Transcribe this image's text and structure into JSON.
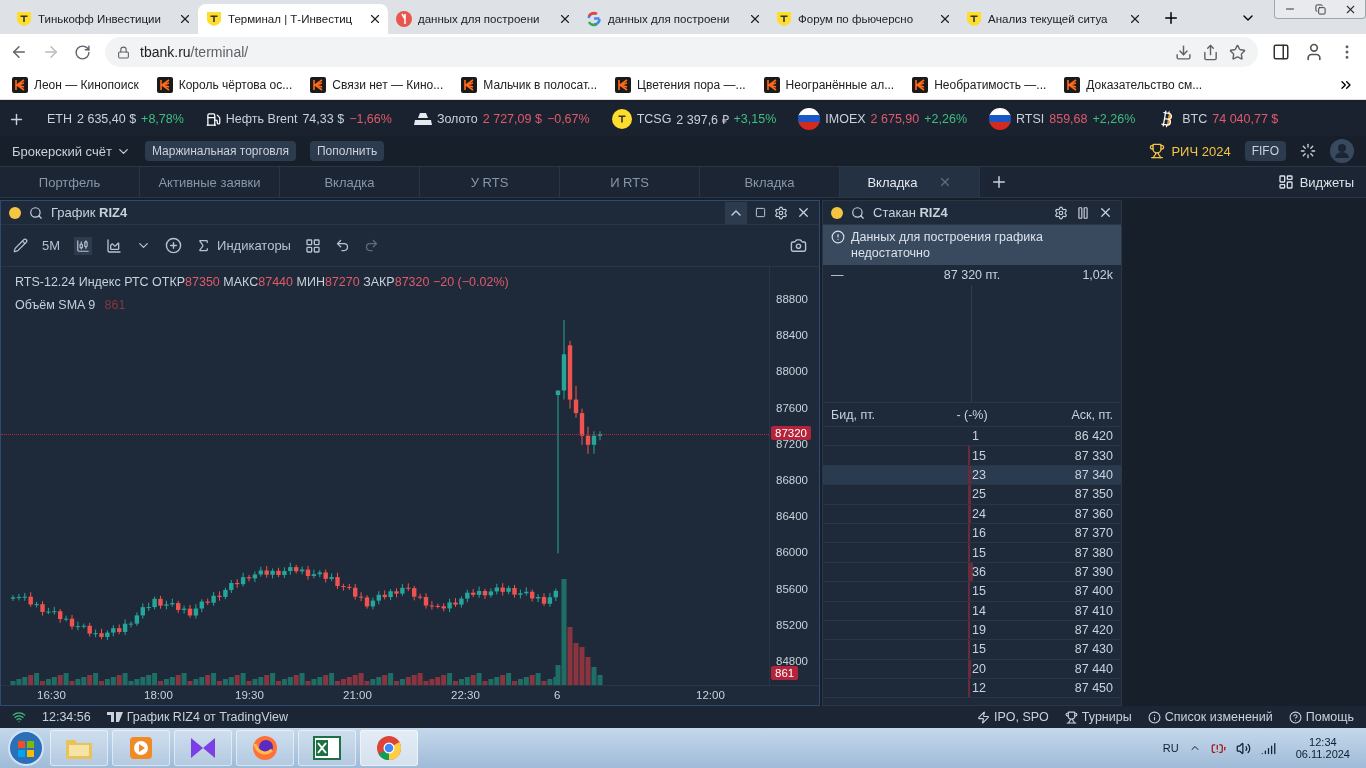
{
  "browser": {
    "tabs": [
      {
        "title": "Тинькофф Инвестиции",
        "kind": "tbank",
        "selected": false
      },
      {
        "title": "Терминал | Т-Инвестиц",
        "kind": "tbank",
        "selected": true
      },
      {
        "title": "данных для построени",
        "kind": "yandex",
        "selected": false
      },
      {
        "title": "данных для построени",
        "kind": "google",
        "selected": false
      },
      {
        "title": "Форум по фьючерсно",
        "kind": "tbank",
        "selected": false
      },
      {
        "title": "Анализ текущей ситуа",
        "kind": "tbank",
        "selected": false
      }
    ],
    "url_host": "tbank.ru",
    "url_path": "/terminal/",
    "bookmarks": [
      "Леон — Кинопоиск",
      "Король чёртова ос...",
      "Связи нет — Кино...",
      "Мальчик в полосат...",
      "Цветения пора —...",
      "Неогранённые ал...",
      "Необратимость —...",
      "Доказательство см..."
    ]
  },
  "ticker": [
    {
      "name": "ETH",
      "kind": "plain",
      "price": "2 635,40 $",
      "price_hot": false,
      "change": "+8,78%",
      "positive": true
    },
    {
      "name": "Нефть Brent",
      "kind": "oil",
      "price": "74,33 $",
      "price_hot": false,
      "change": "−1,66%",
      "positive": false
    },
    {
      "name": "Золото",
      "kind": "gold",
      "price": "2 727,09 $",
      "price_hot": true,
      "change": "−0,67%",
      "positive": false
    },
    {
      "name": "TCSG",
      "kind": "tbank",
      "price": "2 397,6 ₽",
      "price_hot": false,
      "change": "+3,15%",
      "positive": true
    },
    {
      "name": "IMOEX",
      "kind": "flag",
      "price": "2 675,90",
      "price_hot": true,
      "change": "+2,26%",
      "positive": true
    },
    {
      "name": "RTSI",
      "kind": "flag",
      "price": "859,68",
      "price_hot": true,
      "change": "+2,26%",
      "positive": true
    },
    {
      "name": "BTC",
      "kind": "btc",
      "price": "74 040,77 $",
      "price_hot": true
    }
  ],
  "account": {
    "name": "Брокерский счёт",
    "buttons": [
      "Маржинальная торговля",
      "Пополнить"
    ],
    "contest": "РИЧ 2024",
    "badge": "FIFO"
  },
  "workspace_tabs": [
    {
      "label": "Портфель",
      "selected": false
    },
    {
      "label": "Активные заявки",
      "selected": false
    },
    {
      "label": "Вкладка",
      "selected": false
    },
    {
      "label": "У RTS",
      "selected": false
    },
    {
      "label": "И RTS",
      "selected": false
    },
    {
      "label": "Вкладка",
      "selected": false
    },
    {
      "label": "Вкладка",
      "selected": true
    }
  ],
  "widgets_button": "Виджеты",
  "chart_widget": {
    "title": "График",
    "ticker": "RIZ4",
    "timeframe": "5M",
    "indicators": "Индикаторы",
    "symbol": "RTS-12.24 Индекс РТС",
    "ohlc": [
      {
        "label": "ОТКР",
        "value": "87350"
      },
      {
        "label": "МАКС",
        "value": "87440"
      },
      {
        "label": "МИН",
        "value": "87270"
      },
      {
        "label": "ЗАКР",
        "value": "87320"
      }
    ],
    "change": "−20 (−0.02%)",
    "volume_label": "Объём SMA 9",
    "volume_value": "861",
    "price_ticks": [
      "88800",
      "88400",
      "88000",
      "87600",
      "87200",
      "86800",
      "86400",
      "86000",
      "85600",
      "85200",
      "84800"
    ],
    "time_ticks": [
      "16:30",
      "18:00",
      "19:30",
      "21:00",
      "22:30",
      "6",
      "12:00"
    ],
    "last_price": "87320",
    "volume_tag": "861"
  },
  "order_book": {
    "title": "Стакан",
    "ticker": "RIZ4",
    "alert": "Данных для построения графика недостаточно",
    "last_dash": "—",
    "last_price": "87 320 пт.",
    "last_volume": "1,02k",
    "columns": [
      "Бид, пт.",
      "- (-%)",
      "Аск, пт."
    ],
    "rows": [
      {
        "qty": "1",
        "price": "86 420",
        "selected": false
      },
      {
        "qty": "15",
        "price": "87 330",
        "selected": false
      },
      {
        "qty": "23",
        "price": "87 340",
        "selected": true
      },
      {
        "qty": "25",
        "price": "87 350",
        "selected": false
      },
      {
        "qty": "24",
        "price": "87 360",
        "selected": false
      },
      {
        "qty": "16",
        "price": "87 370",
        "selected": false
      },
      {
        "qty": "15",
        "price": "87 380",
        "selected": false
      },
      {
        "qty": "36",
        "price": "87 390",
        "selected": false
      },
      {
        "qty": "15",
        "price": "87 400",
        "selected": false
      },
      {
        "qty": "14",
        "price": "87 410",
        "selected": false
      },
      {
        "qty": "19",
        "price": "87 420",
        "selected": false
      },
      {
        "qty": "15",
        "price": "87 430",
        "selected": false
      },
      {
        "qty": "20",
        "price": "87 440",
        "selected": false
      },
      {
        "qty": "12",
        "price": "87 450",
        "selected": false
      }
    ]
  },
  "status_bar": {
    "time": "12:34:56",
    "source": "График RIZ4 от TradingView",
    "links": [
      {
        "label": "IPO, SPO",
        "kind": "zap"
      },
      {
        "label": "Турниры",
        "kind": "trophy"
      },
      {
        "label": "Список изменений",
        "kind": "info"
      },
      {
        "label": "Помощь",
        "kind": "help"
      }
    ]
  },
  "taskbar": {
    "apps": [
      {
        "kind": "folder",
        "selected": false
      },
      {
        "kind": "media",
        "selected": false
      },
      {
        "kind": "vs",
        "selected": false
      },
      {
        "kind": "firefox",
        "selected": false
      },
      {
        "kind": "excel",
        "selected": false
      },
      {
        "kind": "chrome",
        "selected": true
      }
    ],
    "language": "RU",
    "time": "12:34",
    "date": "06.11.2024"
  }
}
